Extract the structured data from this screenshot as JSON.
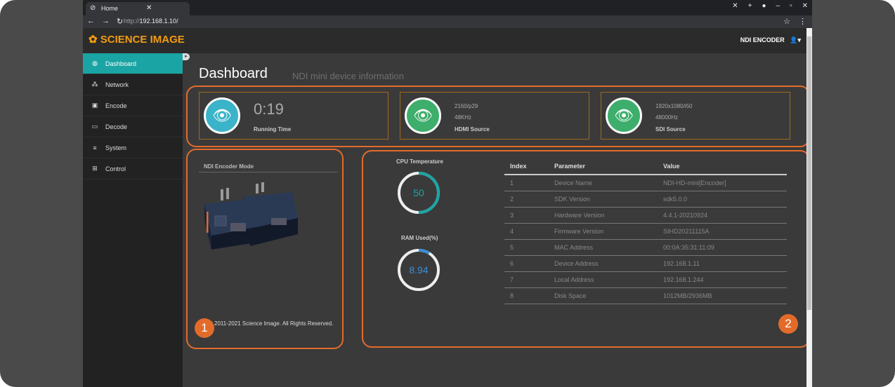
{
  "browser": {
    "tab_title": "Home",
    "url_prefix": "http://",
    "url_host": "192.168.1.10/"
  },
  "app": {
    "logo": "SCIENCE IMAGE",
    "header_right": "NDI ENCODER"
  },
  "sidebar": {
    "items": [
      {
        "label": "Dashboard",
        "icon": "dashboard-icon"
      },
      {
        "label": "Network",
        "icon": "network-icon"
      },
      {
        "label": "Encode",
        "icon": "image-icon"
      },
      {
        "label": "Decode",
        "icon": "monitor-icon"
      },
      {
        "label": "System",
        "icon": "menu-icon"
      },
      {
        "label": "Control",
        "icon": "grid-icon"
      }
    ]
  },
  "page": {
    "title": "Dashboard",
    "subtitle": "NDI mini device information"
  },
  "cards": [
    {
      "value": "0:19",
      "label": "Running Time",
      "color": "#3bb3c9"
    },
    {
      "line1": "2160/p29",
      "line2": "48KHz",
      "label": "HDMI Source",
      "color": "#3dae6b"
    },
    {
      "line1": "1920x1080/i50",
      "line2": "48000Hz",
      "label": "SDI Source",
      "color": "#3dae6b"
    }
  ],
  "encoder_mode": {
    "title": "NDI Encoder Mode",
    "copyright": "ht © 2011-2021 Science Image. All Rights Reserved."
  },
  "gauges": {
    "cpu": {
      "title": "CPU Temperature",
      "value": "50",
      "percent": 50,
      "color": "#1aa5a4"
    },
    "ram": {
      "title": "RAM Used(%)",
      "value": "8.94",
      "percent": 8.94,
      "color": "#3a8fd9"
    }
  },
  "table": {
    "headers": [
      "Index",
      "Parameter",
      "Value"
    ],
    "rows": [
      [
        "1",
        "Device Name",
        "NDI-HD-mini[Encoder]"
      ],
      [
        "2",
        "SDK Version",
        "sdk5.0.0"
      ],
      [
        "3",
        "Hardware Version",
        "4.4.1-20210924"
      ],
      [
        "4",
        "Firmware Version",
        "SIHD20211115A"
      ],
      [
        "5",
        "MAC Address",
        "00:0A:35:31:11:09"
      ],
      [
        "6",
        "Device Address",
        "192.168.1.11"
      ],
      [
        "7",
        "Local Address",
        "192.168.1.244"
      ],
      [
        "8",
        "Disk Space",
        "1012MB/2936MB"
      ]
    ]
  },
  "callouts": [
    "1",
    "2"
  ],
  "colors": {
    "accent": "#1aa5a4",
    "highlight": "#e36b2a",
    "brand": "#f39c12"
  }
}
